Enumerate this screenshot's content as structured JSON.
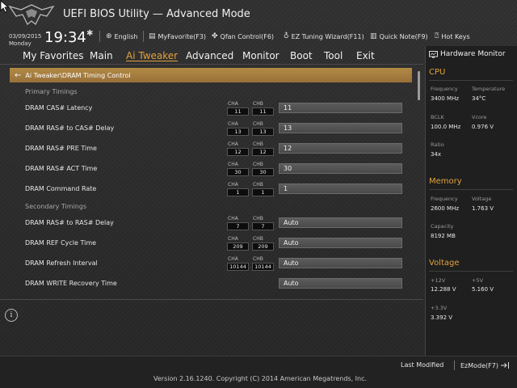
{
  "header": {
    "title": "UEFI BIOS Utility — Advanced Mode",
    "date": "03/09/2015",
    "day": "Monday",
    "time": "19:34",
    "items": [
      {
        "label": "English",
        "icon": "globe-icon"
      },
      {
        "label": "MyFavorite(F3)",
        "icon": "favorite-icon"
      },
      {
        "label": "Qfan Control(F6)",
        "icon": "fan-icon"
      },
      {
        "label": "EZ Tuning Wizard(F11)",
        "icon": "bulb-icon"
      },
      {
        "label": "Quick Note(F9)",
        "icon": "note-icon"
      },
      {
        "label": "Hot Keys",
        "icon": "help-icon"
      }
    ]
  },
  "menu": {
    "items": [
      "My Favorites",
      "Main",
      "Ai Tweaker",
      "Advanced",
      "Monitor",
      "Boot",
      "Tool",
      "Exit"
    ],
    "active": "Ai Tweaker"
  },
  "breadcrumb": "Ai Tweaker\\DRAM Timing Control",
  "sections": {
    "primary": "Primary Timings",
    "secondary": "Secondary Timings"
  },
  "channel_labels": {
    "a": "CHA",
    "b": "CHB"
  },
  "rows": [
    {
      "label": "DRAM CAS# Latency",
      "cha": "11",
      "chb": "11",
      "value": "11"
    },
    {
      "label": "DRAM RAS# to CAS# Delay",
      "cha": "13",
      "chb": "13",
      "value": "13"
    },
    {
      "label": "DRAM RAS# PRE Time",
      "cha": "12",
      "chb": "12",
      "value": "12"
    },
    {
      "label": "DRAM RAS# ACT Time",
      "cha": "30",
      "chb": "30",
      "value": "30"
    },
    {
      "label": "DRAM Command Rate",
      "cha": "1",
      "chb": "1",
      "value": "1"
    },
    {
      "label": "DRAM RAS# to RAS# Delay",
      "cha": "7",
      "chb": "7",
      "value": "Auto"
    },
    {
      "label": "DRAM REF Cycle Time",
      "cha": "209",
      "chb": "209",
      "value": "Auto"
    },
    {
      "label": "DRAM Refresh Interval",
      "cha": "10144",
      "chb": "10144",
      "value": "Auto"
    },
    {
      "label": "DRAM WRITE Recovery Time",
      "cha": "",
      "chb": "",
      "value": "Auto"
    }
  ],
  "hw_monitor": {
    "title": "Hardware Monitor",
    "cpu": {
      "title": "CPU",
      "frequency_label": "Frequency",
      "frequency": "3400 MHz",
      "temperature_label": "Temperature",
      "temperature": "34°C",
      "bclk_label": "BCLK",
      "bclk": "100.0 MHz",
      "vcore_label": "Vcore",
      "vcore": "0.976 V",
      "ratio_label": "Ratio",
      "ratio": "34x"
    },
    "memory": {
      "title": "Memory",
      "frequency_label": "Frequency",
      "frequency": "2600 MHz",
      "voltage_label": "Voltage",
      "voltage": "1.763 V",
      "capacity_label": "Capacity",
      "capacity": "8192 MB"
    },
    "voltage": {
      "title": "Voltage",
      "v12_label": "+12V",
      "v12": "12.288 V",
      "v5_label": "+5V",
      "v5": "5.160 V",
      "v33_label": "+3.3V",
      "v33": "3.392 V"
    }
  },
  "footer": {
    "last_modified": "Last Modified",
    "ezmode": "EzMode(F7)",
    "copyright": "Version 2.16.1240. Copyright (C) 2014 American Megatrends, Inc."
  },
  "colors": {
    "accent": "#e2a23c",
    "breadcrumb": "#a97f3f",
    "background": "#2a2a2a"
  }
}
